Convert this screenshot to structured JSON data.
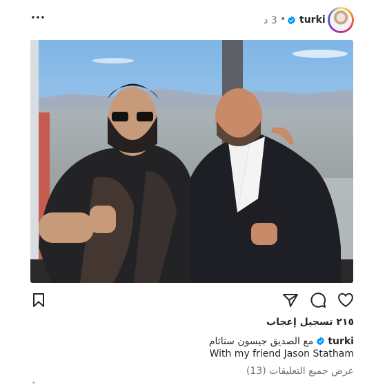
{
  "post": {
    "username": "turki",
    "separator": "•",
    "time": "3 د",
    "verified_icon": "verified-badge-icon",
    "more_icon": "more-horizontal-icon",
    "photo": "photo-two-men-posing-by-window"
  },
  "actions": {
    "like_icon": "heart-icon",
    "comment_icon": "comment-icon",
    "share_icon": "send-icon",
    "save_icon": "bookmark-icon"
  },
  "likes": {
    "label": "٢١٥ تسجيل إعجاب"
  },
  "caption": {
    "username": "turki",
    "arabic": "مع الصديق جيسون ستاثام",
    "english": "With my friend Jason Statham"
  },
  "comments": {
    "label": "عرض جميع التعليقات (13)"
  },
  "next_post": {
    "hint": "•"
  },
  "colors": {
    "verified": "#0095f6",
    "text": "#262626",
    "secondary": "#737373"
  }
}
